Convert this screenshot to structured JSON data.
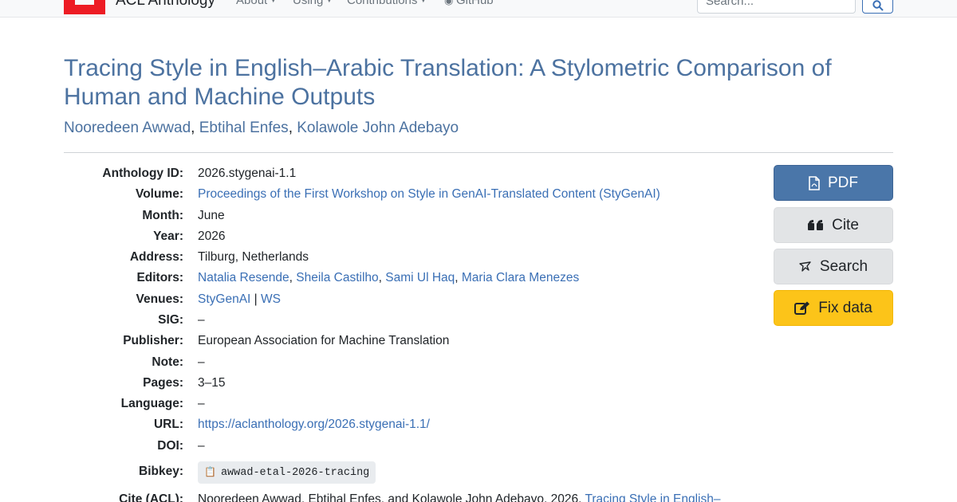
{
  "navbar": {
    "brand": "ACL Anthology",
    "links": [
      "About",
      "Using",
      "Contributions",
      "GitHub"
    ],
    "search_placeholder": "Search..."
  },
  "paper": {
    "title": "Tracing Style in English–Arabic Translation: A Stylometric Comparison of Human and Machine Outputs",
    "authors": [
      "Nooredeen Awwad",
      "Ebtihal Enfes",
      "Kolawole John Adebayo"
    ]
  },
  "meta": {
    "anthology_id": {
      "label": "Anthology ID:",
      "value": "2026.stygenai-1.1"
    },
    "volume": {
      "label": "Volume:",
      "value": "Proceedings of the First Workshop on Style in GenAI-Translated Content (StyGenAI)"
    },
    "month": {
      "label": "Month:",
      "value": "June"
    },
    "year": {
      "label": "Year:",
      "value": "2026"
    },
    "address": {
      "label": "Address:",
      "value": "Tilburg, Netherlands"
    },
    "editors": {
      "label": "Editors:",
      "values": [
        "Natalia Resende",
        "Sheila Castilho",
        "Sami Ul Haq",
        "Maria Clara Menezes"
      ]
    },
    "venues": {
      "label": "Venues:",
      "values": [
        "StyGenAI",
        "WS"
      ]
    },
    "sig": {
      "label": "SIG:",
      "value": "–"
    },
    "publisher": {
      "label": "Publisher:",
      "value": "European Association for Machine Translation"
    },
    "note": {
      "label": "Note:",
      "value": "–"
    },
    "pages": {
      "label": "Pages:",
      "value": "3–15"
    },
    "language": {
      "label": "Language:",
      "value": "–"
    },
    "url": {
      "label": "URL:",
      "value": "https://aclanthology.org/2026.stygenai-1.1/"
    },
    "doi": {
      "label": "DOI:",
      "value": "–"
    },
    "bibkey": {
      "label": "Bibkey:",
      "value": "awwad-etal-2026-tracing"
    },
    "cite_acl": {
      "label": "Cite (ACL):",
      "value": "Nooredeen Awwad, Ebtihal Enfes, and Kolawole John Adebayo. 2026.",
      "link": "Tracing Style in English–"
    }
  },
  "actions": {
    "pdf": "PDF",
    "cite": "Cite",
    "search": "Search",
    "fix": "Fix data"
  },
  "colors": {
    "link": "#3a6fb5",
    "title": "#4c72a0",
    "pdf_button": "#4a76a9",
    "fix_button": "#fcc419"
  }
}
